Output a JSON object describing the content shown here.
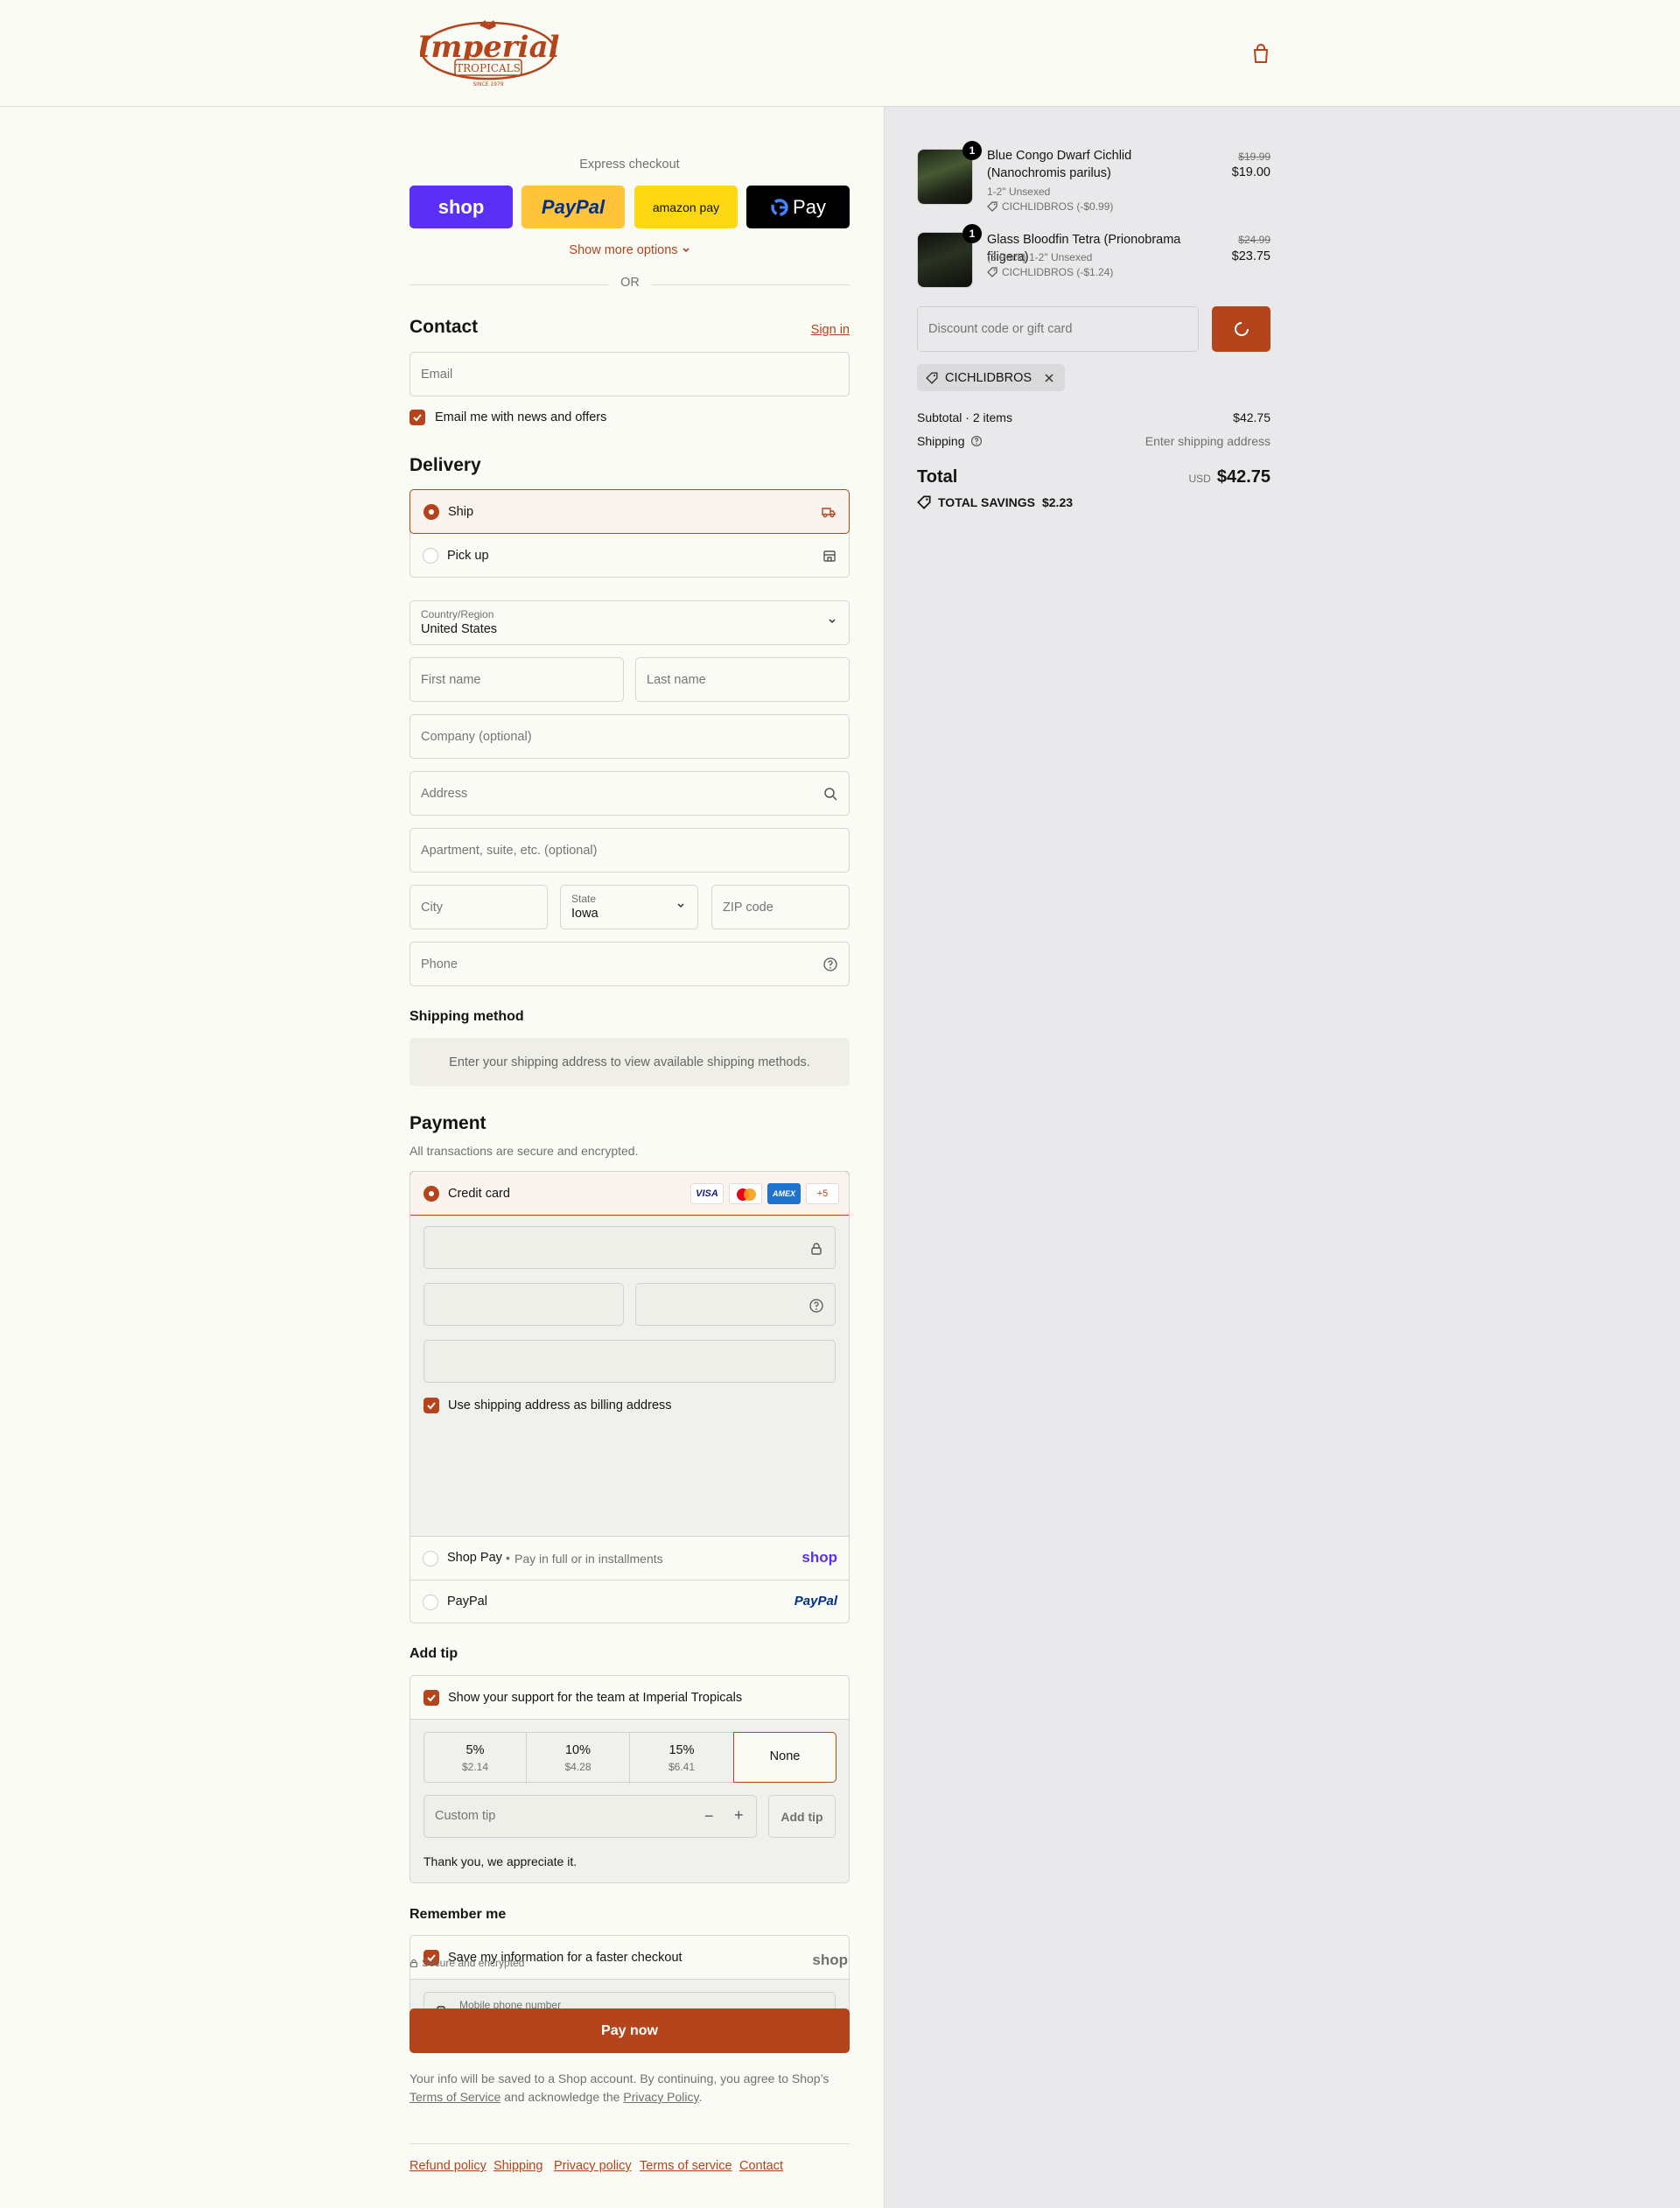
{
  "brand": {
    "name": "Imperial",
    "sub": "TROPICALS",
    "since": "SINCE 1979",
    "color": "#b3441c"
  },
  "express": {
    "title": "Express checkout",
    "buttons": [
      {
        "label": "shop",
        "bg": "#5a31f4"
      },
      {
        "label": "PayPal",
        "bg": "#ffc439"
      },
      {
        "label": "amazon pay",
        "bg": "#ffd814"
      },
      {
        "label": "Pay",
        "bg": "#000000"
      }
    ],
    "show_more": "Show more options",
    "or": "OR"
  },
  "contact": {
    "title": "Contact",
    "sign_in": "Sign in",
    "email_placeholder": "Email",
    "news_label": "Email me with news and offers"
  },
  "delivery": {
    "title": "Delivery",
    "ship": "Ship",
    "pickup": "Pick up",
    "country_label": "Country/Region",
    "country": "United States",
    "first_name": "First name",
    "last_name": "Last name",
    "company": "Company (optional)",
    "address": "Address",
    "apartment": "Apartment, suite, etc. (optional)",
    "city": "City",
    "state_label": "State",
    "state": "Iowa",
    "zip": "ZIP code",
    "phone": "Phone"
  },
  "shipping_method": {
    "title": "Shipping method",
    "message": "Enter your shipping address to view available shipping methods."
  },
  "payment": {
    "title": "Payment",
    "subtitle": "All transactions are secure and encrypted.",
    "credit_card": "Credit card",
    "card_brands": [
      "VISA",
      "MC",
      "AMEX"
    ],
    "more_cards": "+5",
    "billing_label": "Use shipping address as billing address",
    "shop_pay": "Shop Pay",
    "shop_pay_note": "Pay in full or in installments",
    "shop_logo": "shop",
    "paypal": "PayPal",
    "paypal_logo": "PayPal"
  },
  "tip": {
    "title": "Add tip",
    "support_label": "Show your support for the team at Imperial Tropicals",
    "options": [
      {
        "pct": "5%",
        "amt": "$2.14"
      },
      {
        "pct": "10%",
        "amt": "$4.28"
      },
      {
        "pct": "15%",
        "amt": "$6.41"
      },
      {
        "pct": "None",
        "amt": ""
      }
    ],
    "custom_placeholder": "Custom tip",
    "add_button": "Add tip",
    "thanks": "Thank you, we appreciate it."
  },
  "remember": {
    "title": "Remember me",
    "save_label": "Save my information for a faster checkout",
    "mobile_label": "Mobile phone number",
    "mobile_value": "+1",
    "secure": "Secure and encrypted",
    "shop_logo": "shop"
  },
  "pay_now": "Pay now",
  "legal": {
    "pre": "Your info will be saved to a Shop account. By continuing, you agree to Shop’s",
    "terms": "Terms of Service",
    "mid": "and acknowledge the",
    "privacy": "Privacy Policy",
    "end": "."
  },
  "footer_links": [
    "Refund policy",
    "Shipping",
    "Privacy policy",
    "Terms of service",
    "Contact"
  ],
  "order": {
    "items": [
      {
        "qty": "1",
        "name": "Blue Congo Dwarf Cichlid (Nanochromis parilus)",
        "variant": "1-2\" Unsexed",
        "discount": "CICHLIDBROS (-$0.99)",
        "original": "$19.99",
        "price": "$19.00"
      },
      {
        "qty": "1",
        "name": "Glass Bloodfin Tetra (Prionobrama filigera)",
        "variant": "(3 Pack) 1-2\" Unsexed",
        "discount": "CICHLIDBROS (-$1.24)",
        "original": "$24.99",
        "price": "$23.75"
      }
    ],
    "discount_placeholder": "Discount code or gift card",
    "applied_code": "CICHLIDBROS",
    "subtotal_label": "Subtotal · 2 items",
    "subtotal": "$42.75",
    "shipping_label": "Shipping",
    "shipping_value": "Enter shipping address",
    "total_label": "Total",
    "currency": "USD",
    "total": "$42.75",
    "savings_label": "TOTAL SAVINGS",
    "savings": "$2.23"
  }
}
